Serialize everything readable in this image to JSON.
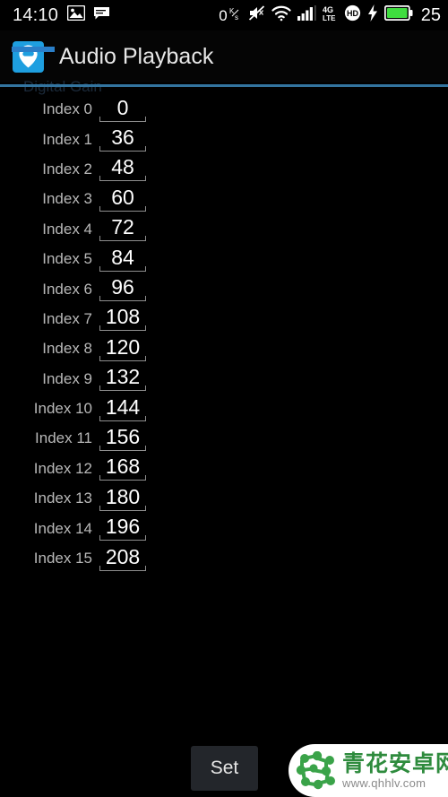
{
  "status_bar": {
    "time": "14:10",
    "left_icons": [
      "image-icon",
      "message-icon"
    ],
    "data_rate": "0",
    "data_rate_unit_top": "K",
    "data_rate_unit_bottom": "s",
    "right_icons": [
      "mute-icon",
      "wifi-icon",
      "signal-bars-icon",
      "4g-lte-icon",
      "hd-icon",
      "charging-bolt-icon",
      "battery-icon"
    ],
    "network_label_top": "4G",
    "network_label_bottom": "LTE",
    "hd_label": "HD",
    "battery_percent": "25",
    "battery_color": "#3fdd3f"
  },
  "action_bar": {
    "title": "Audio Playback",
    "icon_name": "app-icon-location-cloud",
    "icon_background": "#1e9fe0",
    "accent_color": "#2a7fc9"
  },
  "section": {
    "scrolled_label": "Digital Gain",
    "divider_color": "#33749f"
  },
  "list": {
    "rows": [
      {
        "label": "Index 0",
        "value": "0"
      },
      {
        "label": "Index 1",
        "value": "36"
      },
      {
        "label": "Index 2",
        "value": "48"
      },
      {
        "label": "Index 3",
        "value": "60"
      },
      {
        "label": "Index 4",
        "value": "72"
      },
      {
        "label": "Index 5",
        "value": "84"
      },
      {
        "label": "Index 6",
        "value": "96"
      },
      {
        "label": "Index 7",
        "value": "108"
      },
      {
        "label": "Index 8",
        "value": "120"
      },
      {
        "label": "Index 9",
        "value": "132"
      },
      {
        "label": "Index 10",
        "value": "144"
      },
      {
        "label": "Index 11",
        "value": "156"
      },
      {
        "label": "Index 12",
        "value": "168"
      },
      {
        "label": "Index 13",
        "value": "180"
      },
      {
        "label": "Index 14",
        "value": "196"
      },
      {
        "label": "Index 15",
        "value": "208"
      }
    ]
  },
  "bottom_bar": {
    "set_label": "Set"
  },
  "watermark": {
    "brand_cn": "青花安卓网",
    "url": "www.qhhlv.com",
    "logo_color": "#2e8b3d",
    "text_color": "#2e8b3d"
  }
}
